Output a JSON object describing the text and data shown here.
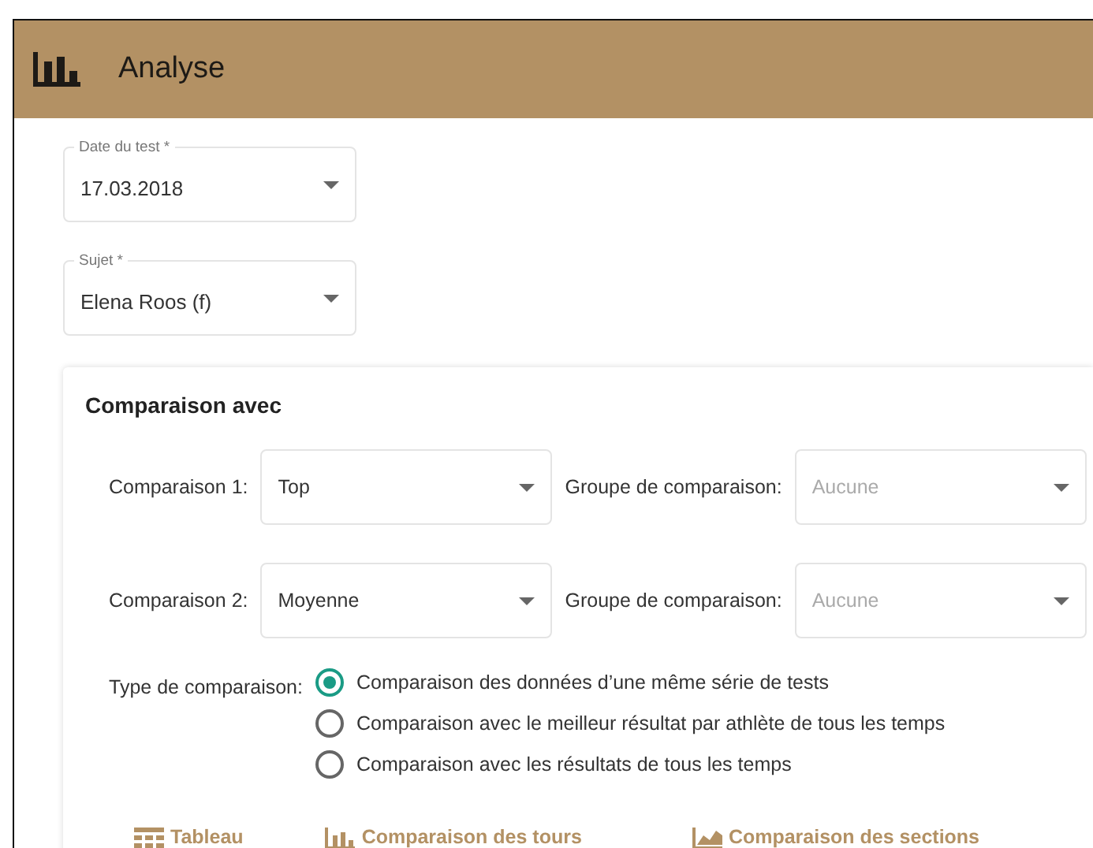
{
  "header": {
    "title": "Analyse"
  },
  "fields": [
    {
      "label": "Date du test *",
      "value": "17.03.2018"
    },
    {
      "label": "Sujet *",
      "value": "Elena Roos (f)"
    }
  ],
  "comparison": {
    "title": "Comparaison avec",
    "rows": [
      {
        "label": "Comparaison 1:",
        "value": "Top",
        "group_label": "Groupe de comparaison:",
        "group_placeholder": "Aucune"
      },
      {
        "label": "Comparaison 2:",
        "value": "Moyenne",
        "group_label": "Groupe de comparaison:",
        "group_placeholder": "Aucune"
      }
    ],
    "type_label": "Type de comparaison:",
    "options": [
      {
        "label": "Comparaison des données d’une même série de tests",
        "selected": true
      },
      {
        "label": "Comparaison avec le meilleur résultat par athlète de tous les temps",
        "selected": false
      },
      {
        "label": "Comparaison avec les résultats de tous les temps",
        "selected": false
      }
    ]
  },
  "views": [
    {
      "kind": "table",
      "label": "Tableau"
    },
    {
      "kind": "bars",
      "label": "Comparaison des tours"
    },
    {
      "kind": "area",
      "label": "Comparaison des sections"
    }
  ]
}
